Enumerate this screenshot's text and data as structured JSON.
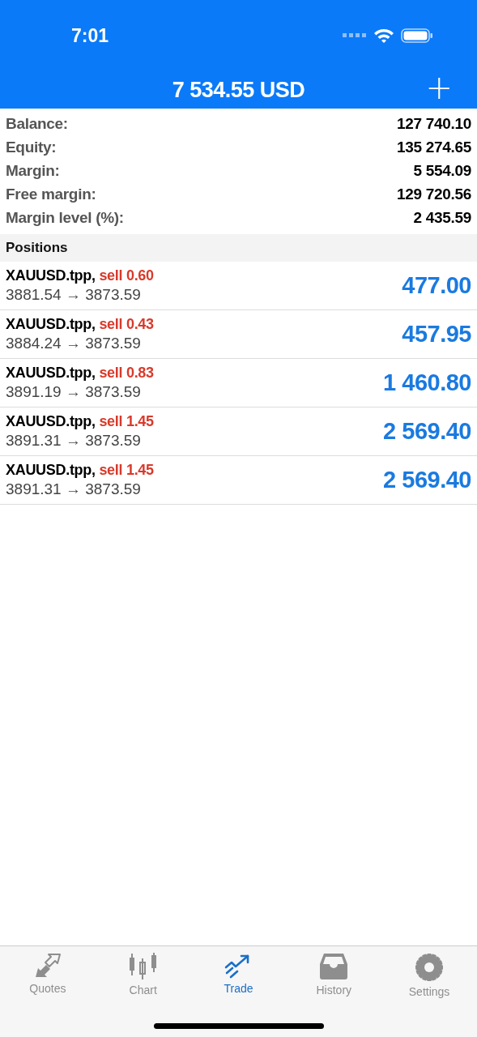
{
  "status_bar": {
    "time": "7:01"
  },
  "header": {
    "title": "7 534.55 USD",
    "action": "+"
  },
  "summary": [
    {
      "label": "Balance:",
      "value": "127 740.10"
    },
    {
      "label": "Equity:",
      "value": "135 274.65"
    },
    {
      "label": "Margin:",
      "value": "5 554.09"
    },
    {
      "label": "Free margin:",
      "value": "129 720.56"
    },
    {
      "label": "Margin level (%):",
      "value": "2 435.59"
    }
  ],
  "positions": {
    "title": "Positions",
    "items": [
      {
        "symbol": "XAUUSD.tpp,",
        "kind": "sell",
        "order": "sell 0.60",
        "prices": "3881.54 → 3873.59",
        "profit": "477.00"
      },
      {
        "symbol": "XAUUSD.tpp,",
        "kind": "sell",
        "order": "sell 0.43",
        "prices": "3884.24 → 3873.59",
        "profit": "457.95"
      },
      {
        "symbol": "XAUUSD.tpp,",
        "kind": "sell",
        "order": "sell 0.83",
        "prices": "3891.19 → 3873.59",
        "profit": "1 460.80"
      },
      {
        "symbol": "XAUUSD.tpp,",
        "kind": "sell",
        "order": "sell 1.45",
        "prices": "3891.31 → 3873.59",
        "profit": "2 569.40"
      },
      {
        "symbol": "XAUUSD.tpp,",
        "kind": "sell",
        "order": "sell 1.45",
        "prices": "3891.31 → 3873.59",
        "profit": "2 569.40"
      }
    ]
  },
  "tabs": [
    {
      "label": "Quotes",
      "kind": "quotes",
      "selected": false
    },
    {
      "label": "Chart",
      "kind": "chart",
      "selected": false
    },
    {
      "label": "Trade",
      "kind": "trade",
      "selected": true
    },
    {
      "label": "History",
      "kind": "history",
      "selected": false
    },
    {
      "label": "Settings",
      "kind": "settings",
      "selected": false
    }
  ]
}
